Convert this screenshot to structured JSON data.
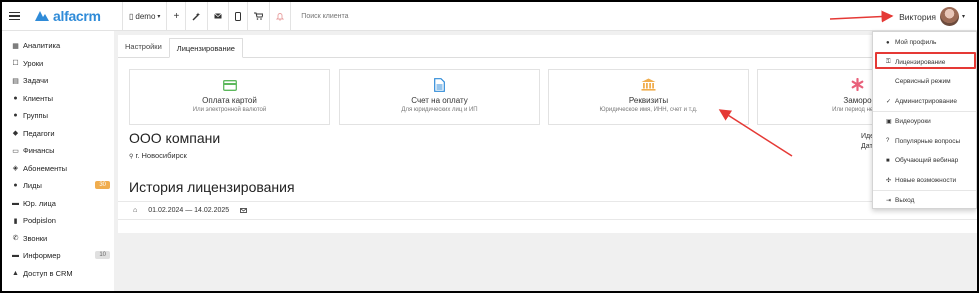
{
  "brand": {
    "logo_text": "alfacrm",
    "accent": "#2f8bd8"
  },
  "toolbar": {
    "branch": "demo",
    "add_icon": "plus-icon",
    "wand_icon": "magic-wand-icon",
    "mail_icon": "envelope-icon",
    "phone_icon": "mobile-icon",
    "cart_icon": "cart-icon",
    "bell_icon": "bell-icon",
    "search_placeholder": "Поиск клиента"
  },
  "user": {
    "name": "Виктория"
  },
  "sidebar": {
    "items": [
      {
        "label": "Аналитика",
        "icon": "dashboard-icon",
        "glyph": "▦"
      },
      {
        "label": "Уроки",
        "icon": "calendar-icon",
        "glyph": "☐"
      },
      {
        "label": "Задачи",
        "icon": "tasks-icon",
        "glyph": "▤"
      },
      {
        "label": "Клиенты",
        "icon": "user-icon",
        "glyph": "●"
      },
      {
        "label": "Группы",
        "icon": "group-icon",
        "glyph": "●"
      },
      {
        "label": "Педагоги",
        "icon": "teacher-icon",
        "glyph": "◆"
      },
      {
        "label": "Финансы",
        "icon": "money-icon",
        "glyph": "▭"
      },
      {
        "label": "Абонементы",
        "icon": "tag-icon",
        "glyph": "◈"
      },
      {
        "label": "Лиды",
        "icon": "leads-icon",
        "glyph": "●",
        "badge": "30",
        "badge_color": "#f0ad4e"
      },
      {
        "label": "Юр. лица",
        "icon": "briefcase-icon",
        "glyph": "▬"
      },
      {
        "label": "Podpislon",
        "icon": "file-icon",
        "glyph": "▮"
      },
      {
        "label": "Звонки",
        "icon": "phone-icon",
        "glyph": "✆"
      },
      {
        "label": "Информер",
        "icon": "informer-icon",
        "glyph": "▬",
        "badge": "10",
        "badge_color": "#e0e0e0"
      },
      {
        "label": "Доступ в CRM",
        "icon": "lock-icon",
        "glyph": "▲"
      }
    ]
  },
  "tabs": [
    {
      "label": "Настройки"
    },
    {
      "label": "Лицензирование"
    }
  ],
  "cards": [
    {
      "title": "Оплата картой",
      "subtitle": "Или электронной валютой",
      "icon": "credit-card-icon",
      "color": "#5cb85c"
    },
    {
      "title": "Счет на оплату",
      "subtitle": "Для юридических лиц и ИП",
      "icon": "document-icon",
      "color": "#2f8bd8"
    },
    {
      "title": "Реквизиты",
      "subtitle": "Юридическое имя, ИНН, счет и т.д.",
      "icon": "bank-icon",
      "color": "#f0ad4e"
    },
    {
      "title": "Заморо",
      "subtitle": "Или период неисп",
      "icon": "asterisk-icon",
      "color": "#e8607a"
    }
  ],
  "company": {
    "name": "ООО компани",
    "city": "г. Новосибирск",
    "right_labels": [
      "Иде",
      "Дата"
    ]
  },
  "history": {
    "title": "История лицензирования",
    "rows": [
      {
        "period": "01.02.2024 — 14.02.2025"
      }
    ]
  },
  "user_menu": {
    "items": [
      {
        "label": "Мой профиль",
        "glyph": "●"
      },
      {
        "label": "Лицензирование",
        "glyph": "🔒"
      },
      {
        "label": "Сервисный режим",
        "glyph": ""
      },
      {
        "label": "Администрирование",
        "glyph": "✓"
      },
      {
        "label": "Видеоуроки",
        "glyph": "▣"
      },
      {
        "label": "Популярные вопросы",
        "glyph": "?"
      },
      {
        "label": "Обучающий вебинар",
        "glyph": "■"
      },
      {
        "label": "Новые возможности",
        "glyph": "✣"
      },
      {
        "label": "Выход",
        "glyph": "⇥"
      }
    ]
  },
  "annotation_color": "#e53935"
}
